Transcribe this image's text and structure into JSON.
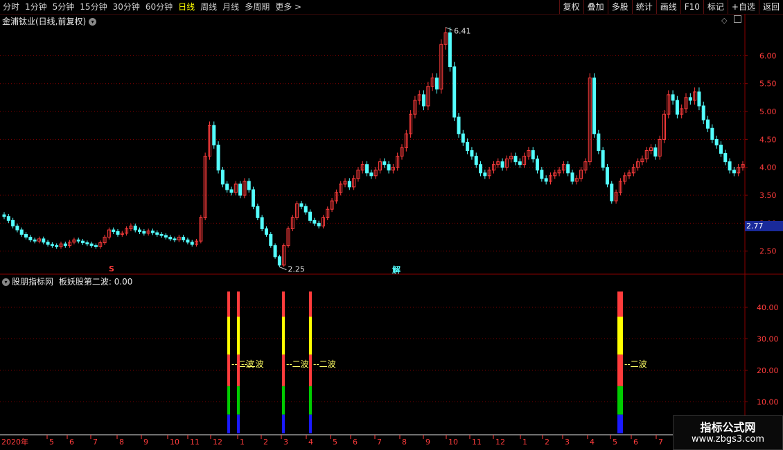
{
  "toolbar": {
    "periods": [
      "分时",
      "1分钟",
      "5分钟",
      "15分钟",
      "30分钟",
      "60分钟",
      "日线",
      "周线",
      "月线",
      "多周期",
      "更多 >"
    ],
    "active_period": "日线",
    "buttons": [
      "复权",
      "叠加",
      "多股",
      "统计",
      "画线",
      "F10",
      "标记",
      "+自选",
      "返回"
    ]
  },
  "main_panel": {
    "title": "金浦钛业(日线,前复权)",
    "high_label": "6.41",
    "low_label": "2.25",
    "last_price": "2.77",
    "y_ticks": [
      "6.00",
      "5.50",
      "5.00",
      "4.50",
      "4.00",
      "3.50",
      "3.00",
      "2.50"
    ],
    "markers": {
      "s": "S",
      "jie": "解"
    }
  },
  "indicator_panel": {
    "title": "股朋指标网",
    "subtitle": "板妖股第二波: 0.00",
    "y_ticks": [
      "40.00",
      "30.00",
      "20.00",
      "10.00"
    ],
    "wave_text": "--二波"
  },
  "date_axis": [
    "2020年",
    "5",
    "6",
    "7",
    "8",
    "9",
    "10",
    "11",
    "12",
    "1",
    "2",
    "3",
    "4",
    "5",
    "6",
    "7",
    "8",
    "9",
    "10",
    "11",
    "12",
    "1",
    "2",
    "3",
    "4",
    "5",
    "6",
    "7"
  ],
  "watermark": {
    "line1": "指标公式网",
    "line2": "www.zbgs3.com"
  },
  "colors": {
    "up": "#ff3c3c",
    "down": "#54ffff",
    "grid": "#8b0000",
    "yellow": "#ffff00",
    "green": "#00cc00",
    "blue": "#1a1aff"
  },
  "chart_data": {
    "type": "candlestick",
    "closes": [
      3.12,
      3.05,
      2.95,
      2.88,
      2.8,
      2.75,
      2.7,
      2.68,
      2.72,
      2.66,
      2.62,
      2.6,
      2.58,
      2.63,
      2.6,
      2.66,
      2.7,
      2.68,
      2.65,
      2.63,
      2.6,
      2.58,
      2.65,
      2.75,
      2.88,
      2.85,
      2.8,
      2.82,
      2.9,
      2.95,
      2.88,
      2.85,
      2.82,
      2.86,
      2.83,
      2.8,
      2.78,
      2.75,
      2.72,
      2.7,
      2.75,
      2.7,
      2.66,
      2.62,
      2.68,
      3.1,
      4.2,
      4.75,
      4.4,
      3.95,
      3.7,
      3.6,
      3.55,
      3.7,
      3.5,
      3.75,
      3.6,
      3.3,
      3.1,
      2.9,
      2.8,
      2.6,
      2.4,
      2.25,
      2.6,
      2.9,
      3.1,
      3.35,
      3.3,
      3.2,
      3.05,
      3.0,
      2.95,
      3.1,
      3.25,
      3.4,
      3.55,
      3.7,
      3.75,
      3.65,
      3.8,
      3.95,
      4.05,
      3.9,
      3.85,
      3.95,
      4.1,
      4.05,
      3.95,
      4.0,
      4.2,
      4.35,
      4.6,
      4.95,
      5.2,
      5.3,
      5.1,
      5.45,
      5.6,
      5.4,
      6.2,
      6.41,
      5.8,
      4.9,
      4.6,
      4.45,
      4.3,
      4.2,
      4.05,
      3.9,
      3.85,
      3.95,
      4.05,
      4.1,
      4.0,
      4.15,
      4.2,
      4.1,
      4.05,
      4.2,
      4.3,
      4.15,
      3.95,
      3.8,
      3.75,
      3.85,
      3.9,
      3.95,
      4.05,
      3.9,
      3.75,
      3.8,
      3.95,
      4.1,
      5.6,
      4.6,
      4.3,
      4.0,
      3.7,
      3.4,
      3.55,
      3.75,
      3.85,
      3.9,
      4.0,
      4.1,
      4.15,
      4.3,
      4.35,
      4.2,
      4.5,
      4.95,
      5.3,
      5.2,
      4.95,
      5.05,
      5.25,
      5.2,
      5.35,
      5.1,
      4.85,
      4.7,
      4.5,
      4.4,
      4.25,
      4.1,
      3.95,
      3.9,
      4.0,
      4.05
    ],
    "price_ylim": [
      2.1,
      6.55
    ],
    "high": 6.41,
    "low": 2.25,
    "last_price": 2.77,
    "indicator_bars": [
      {
        "index": 0,
        "label": "二波"
      },
      {
        "index": 1,
        "label": "二波"
      },
      {
        "index": 2,
        "label": "二波"
      },
      {
        "index": 3,
        "label": "二波"
      },
      {
        "index": 4,
        "label": "二波"
      }
    ],
    "indicator_ylim": [
      0,
      47
    ]
  }
}
